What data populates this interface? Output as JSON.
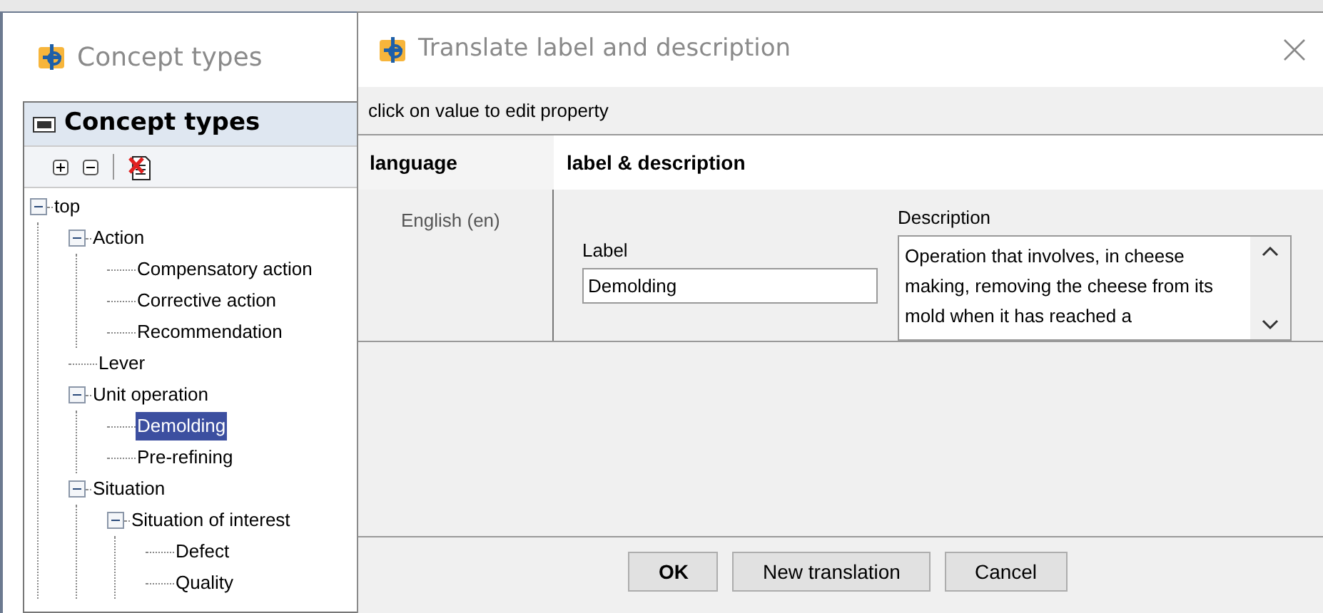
{
  "main_window": {
    "title": "Concept types"
  },
  "panel": {
    "title": "Concept types"
  },
  "tree": [
    {
      "label": "top",
      "expanded": true,
      "selected": false,
      "children": [
        {
          "label": "Action",
          "expanded": true,
          "selected": false,
          "children": [
            {
              "label": "Compensatory action",
              "selected": false
            },
            {
              "label": "Corrective action",
              "selected": false
            },
            {
              "label": "Recommendation",
              "selected": false
            }
          ]
        },
        {
          "label": "Lever",
          "selected": false
        },
        {
          "label": "Unit operation",
          "expanded": true,
          "selected": false,
          "children": [
            {
              "label": "Demolding",
              "selected": true
            },
            {
              "label": "Pre-refining",
              "selected": false
            }
          ]
        },
        {
          "label": "Situation",
          "expanded": true,
          "selected": false,
          "children": [
            {
              "label": "Situation of interest",
              "expanded": true,
              "selected": false,
              "children": [
                {
                  "label": "Defect",
                  "selected": false
                },
                {
                  "label": "Quality",
                  "selected": false
                }
              ]
            }
          ]
        }
      ]
    }
  ],
  "dialog": {
    "title": "Translate label and description",
    "hint": "click on value to edit property",
    "columns": [
      "language",
      "label & description"
    ],
    "rows": [
      {
        "language": "English (en)",
        "label_caption": "Label",
        "label_value": "Demolding",
        "description_caption": "Description",
        "description_value": "Operation that involves, in cheese making, removing the cheese from its mold when it has reached a"
      }
    ],
    "buttons": [
      {
        "label": "OK",
        "default": true
      },
      {
        "label": "New translation",
        "default": false
      },
      {
        "label": "Cancel",
        "default": false
      }
    ]
  }
}
